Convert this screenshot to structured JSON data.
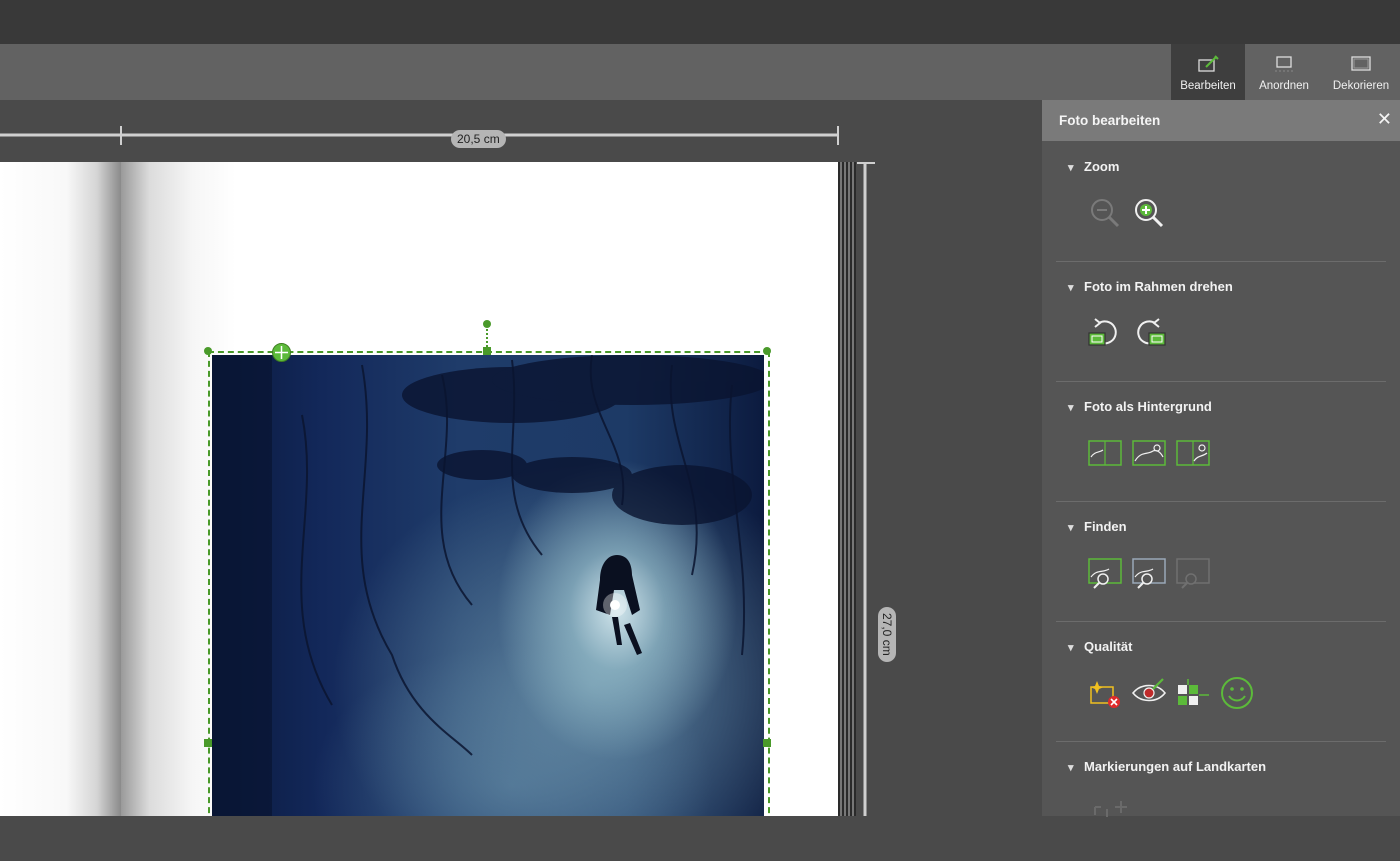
{
  "toolbar": {
    "tabs": [
      {
        "label": "Bearbeiten",
        "icon": "edit-frame-icon",
        "active": true
      },
      {
        "label": "Anordnen",
        "icon": "arrange-icon",
        "active": false
      },
      {
        "label": "Dekorieren",
        "icon": "decorate-icon",
        "active": false
      }
    ]
  },
  "canvas": {
    "width_label": "20,5 cm",
    "height_label": "27,0 cm"
  },
  "panel": {
    "title": "Foto bearbeiten",
    "close_icon": "close-icon",
    "sections": [
      {
        "title": "Zoom",
        "icons": [
          "zoom-out-icon",
          "zoom-in-icon"
        ]
      },
      {
        "title": "Foto im Rahmen drehen",
        "icons": [
          "rotate-left-icon",
          "rotate-right-icon"
        ]
      },
      {
        "title": "Foto als Hintergrund",
        "icons": [
          "background-left-icon",
          "background-full-icon",
          "background-right-icon"
        ]
      },
      {
        "title": "Finden",
        "icons": [
          "find-photo-icon",
          "find-similar-icon",
          "find-disabled-icon"
        ]
      },
      {
        "title": "Qualität",
        "icons": [
          "auto-enhance-icon",
          "red-eye-icon",
          "grid-icon",
          "smile-icon"
        ]
      },
      {
        "title": "Markierungen auf Landkarten",
        "icons": [
          "map-marker-icon"
        ]
      }
    ]
  },
  "colors": {
    "accent": "#4a9a2a",
    "panel_bg": "#555555",
    "panel_header": "#7a7a7a",
    "toolbar_bg": "#626262",
    "titlebar_bg": "#393939"
  }
}
